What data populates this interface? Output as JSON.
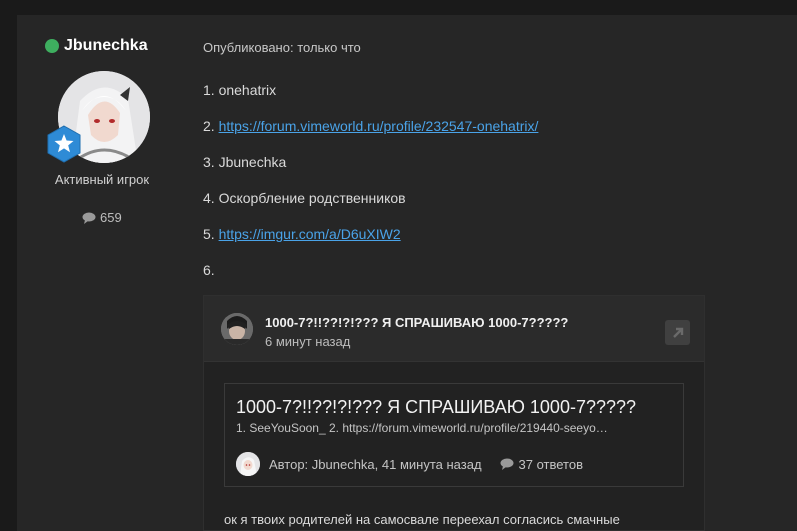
{
  "author": {
    "username": "Jbunechka",
    "rank": "Активный игрок",
    "post_count": "659"
  },
  "post": {
    "published": "Опубликовано: только что",
    "lines": [
      {
        "prefix": "1. ",
        "text": "onehatrix"
      },
      {
        "prefix": "2. ",
        "link": "https://forum.vimeworld.ru/profile/232547-onehatrix/"
      },
      {
        "prefix": "3. ",
        "text": "Jbunechka"
      },
      {
        "prefix": "4. ",
        "text": "Оскорбление родственников"
      },
      {
        "prefix": "5. ",
        "link": "https://imgur.com/a/D6uXIW2"
      },
      {
        "prefix": "6.",
        "text": ""
      }
    ]
  },
  "embed": {
    "title": "1000-7?!!??!?!??? Я СПРАШИВАЮ 1000-7?????",
    "time": "6 минут назад",
    "card": {
      "title": "1000-7?!!??!?!??? Я СПРАШИВАЮ 1000-7?????",
      "snippet": "1. SeeYouSoon_ 2. https://forum.vimeworld.ru/profile/219440-seeyo…",
      "author_meta": "Автор: Jbunechka, 41 минута назад",
      "replies": "37 ответов"
    },
    "body": "ок я твоих родителей на самосвале переехал согласись смачные"
  },
  "colors": {
    "online": "#3eae5f",
    "link": "#4aa3e8",
    "badge": "#2e8bd6"
  },
  "icons": [
    "online-status-icon",
    "rank-star-badge-icon",
    "comment-icon",
    "external-link-icon"
  ]
}
